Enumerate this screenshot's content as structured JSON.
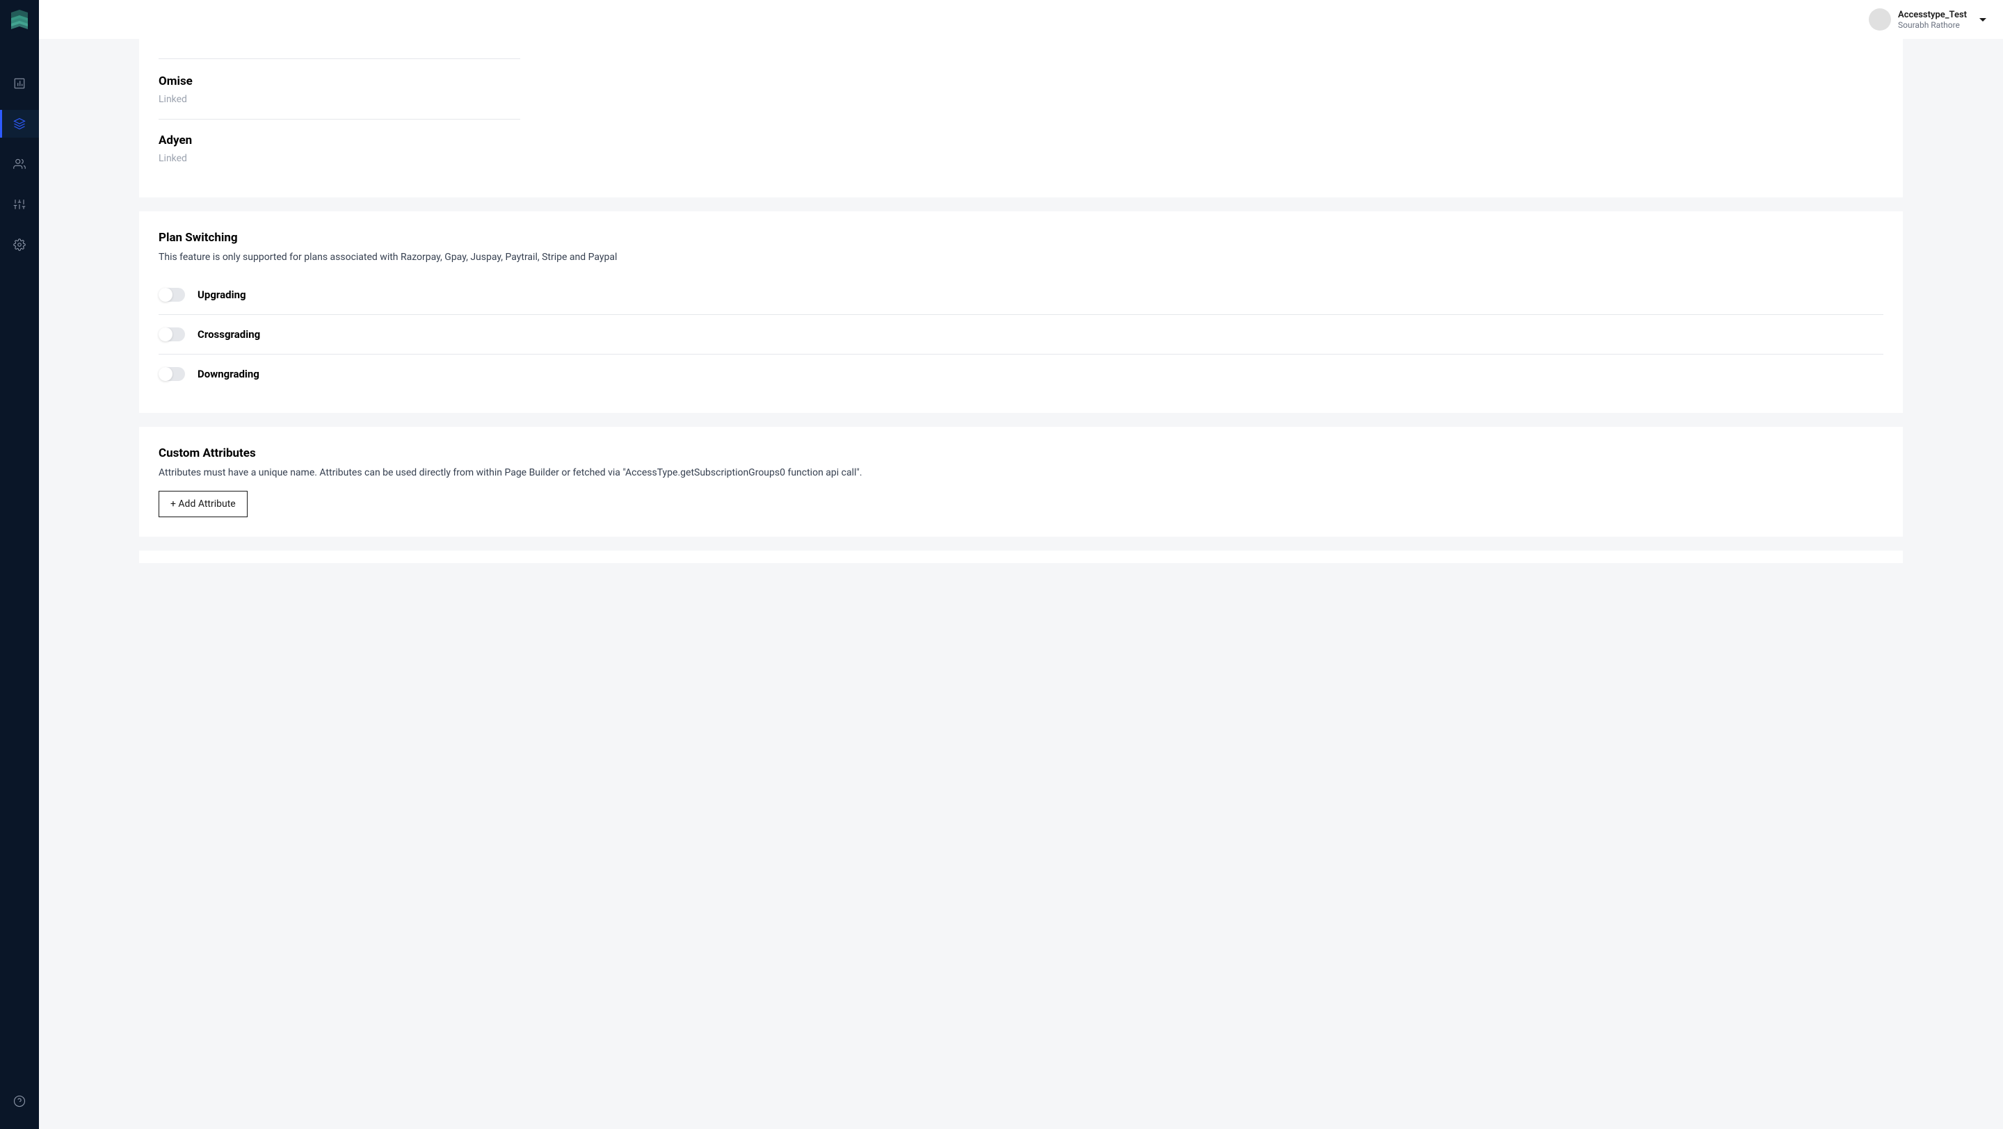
{
  "header": {
    "user_name": "Accesstype_Test",
    "user_subtitle": "Sourabh Rathore"
  },
  "payments": {
    "items": [
      {
        "name": "Omise",
        "status": "Linked"
      },
      {
        "name": "Adyen",
        "status": "Linked"
      }
    ]
  },
  "plan_switching": {
    "title": "Plan Switching",
    "description": "This feature is only supported for plans associated with Razorpay, Gpay, Juspay, Paytrail, Stripe and Paypal",
    "options": [
      {
        "label": "Upgrading",
        "enabled": false
      },
      {
        "label": "Crossgrading",
        "enabled": false
      },
      {
        "label": "Downgrading",
        "enabled": false
      }
    ]
  },
  "custom_attributes": {
    "title": "Custom Attributes",
    "description": "Attributes must have a unique name. Attributes can be used directly from within Page Builder or fetched via \"AccessType.getSubscriptionGroups0 function api call\".",
    "button_label": "+ Add Attribute"
  }
}
